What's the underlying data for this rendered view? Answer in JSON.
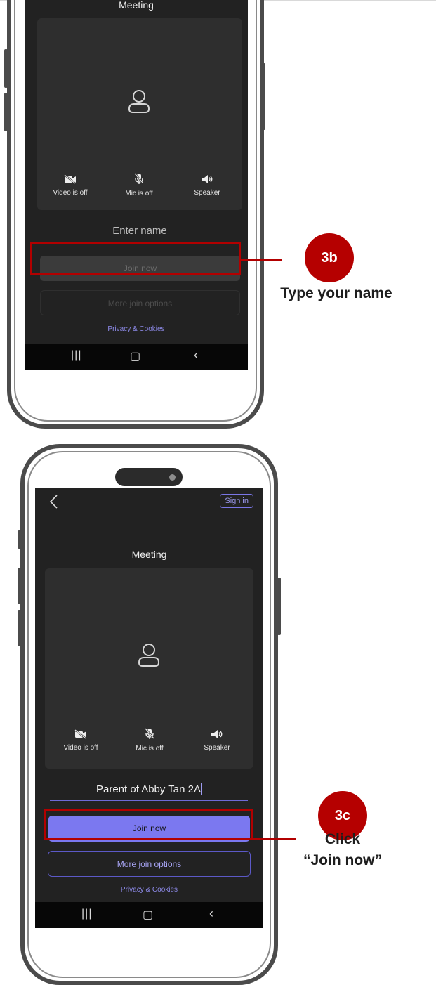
{
  "phone1": {
    "title": "Meeting",
    "controls": {
      "video": "Video is off",
      "mic": "Mic is off",
      "speaker": "Speaker"
    },
    "name_placeholder": "Enter name",
    "join_label": "Join now",
    "more_label": "More join options",
    "privacy_label": "Privacy & Cookies"
  },
  "phone2": {
    "signin_label": "Sign in",
    "title": "Meeting",
    "controls": {
      "video": "Video is off",
      "mic": "Mic is off",
      "speaker": "Speaker"
    },
    "name_value": "Parent of Abby Tan 2A",
    "join_label": "Join now",
    "more_label": "More join options",
    "privacy_label": "Privacy & Cookies"
  },
  "annotations": {
    "step_3b": {
      "badge": "3b",
      "caption": "Type your name"
    },
    "step_3c": {
      "badge": "3c",
      "caption_line1": "Click",
      "caption_line2": "“Join now”"
    }
  },
  "colors": {
    "screen_bg": "#222222",
    "preview_bg": "#2e2e2e",
    "accent": "#7b78f0",
    "highlight_red": "#b20000",
    "badge_red": "#b50000"
  },
  "icons": [
    "video-off-icon",
    "mic-off-icon",
    "speaker-icon",
    "avatar-icon",
    "back-chevron-icon",
    "nav-recent-icon",
    "nav-home-icon",
    "nav-back-icon"
  ]
}
